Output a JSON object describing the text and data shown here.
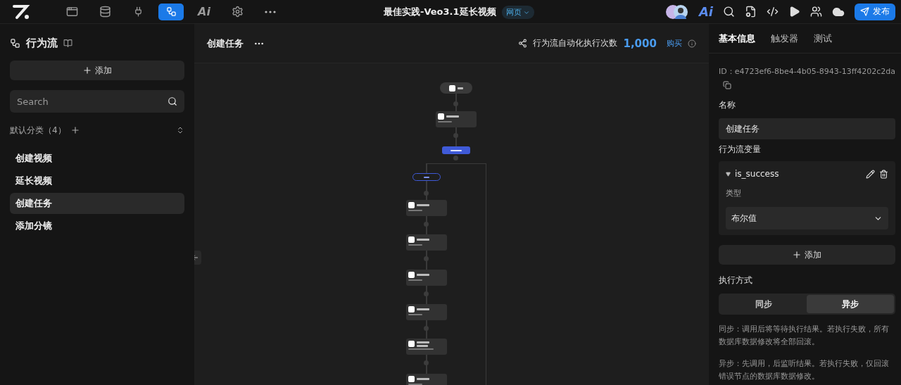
{
  "topbar": {
    "nav": [
      {
        "kind": "app",
        "selected": false
      },
      {
        "kind": "database",
        "selected": false
      },
      {
        "kind": "plug",
        "selected": false
      },
      {
        "kind": "flow",
        "selected": true
      },
      {
        "kind": "ai",
        "label": "Ai",
        "selected": false
      },
      {
        "kind": "settings",
        "selected": false
      },
      {
        "kind": "more",
        "selected": false
      }
    ],
    "title": "最佳实践-Veo3.1延长视频",
    "badge": "网页",
    "ai_label": "Ai",
    "publish": "发布"
  },
  "sidebar": {
    "title": "行为流",
    "add": "添加",
    "search": {
      "placeholder": "Search"
    },
    "category": "默认分类（4）",
    "items": [
      {
        "label": "创建视频",
        "selected": false
      },
      {
        "label": "延长视频",
        "selected": false
      },
      {
        "label": "创建任务",
        "selected": true
      },
      {
        "label": "添加分镜",
        "selected": false
      }
    ]
  },
  "canvas": {
    "title": "创建任务",
    "counter_label": "行为流自动化执行次数",
    "counter": "1,000",
    "buy": "购买",
    "nodes": [
      {
        "kind": "start"
      },
      {
        "kind": "card"
      },
      {
        "kind": "condition"
      },
      {
        "kind": "branch"
      },
      {
        "kind": "card"
      },
      {
        "kind": "card"
      },
      {
        "kind": "card"
      },
      {
        "kind": "card"
      },
      {
        "kind": "tall"
      },
      {
        "kind": "card"
      }
    ]
  },
  "panel": {
    "tabs": [
      {
        "label": "基本信息",
        "selected": true
      },
      {
        "label": "触发器",
        "selected": false
      },
      {
        "label": "测试",
        "selected": false
      }
    ],
    "id": "ID：e4723ef6-8be4-4b05-8943-13ff4202c2da",
    "name_label": "名称",
    "name_value": "创建任务",
    "vars_label": "行为流变量",
    "variable": {
      "name": "is_success",
      "expanded": true,
      "type_label": "类型",
      "type_value": "布尔值"
    },
    "add": "添加",
    "mode_label": "执行方式",
    "modes": [
      {
        "label": "同步",
        "selected": false
      },
      {
        "label": "异步",
        "selected": true
      }
    ],
    "notes": [
      "同步：调用后将等待执行结果。若执行失败，所有数据库数据修改将全部回滚。",
      "异步：先调用，后监听结果。若执行失败，仅回滚错误节点的数据库数据修改。"
    ]
  }
}
